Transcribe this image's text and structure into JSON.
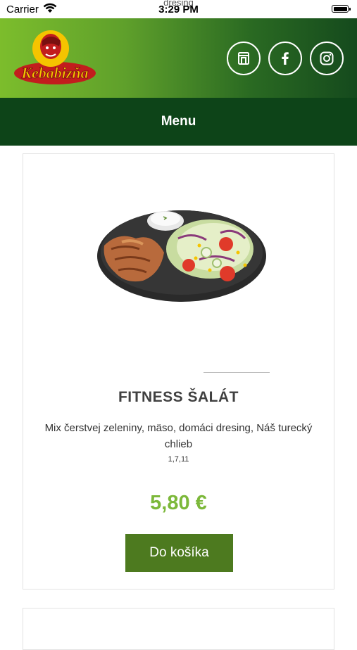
{
  "status_bar": {
    "carrier": "Carrier",
    "time": "3:29 PM",
    "ghost_text": "dresing"
  },
  "header": {
    "logo_text": "Kebabizňa",
    "social_icons": [
      "shop-icon",
      "facebook-icon",
      "instagram-icon"
    ],
    "colors": {
      "gradient_start": "#7cbd2c",
      "gradient_end": "#154a1d"
    }
  },
  "nav": {
    "menu_label": "Menu",
    "color": "#0d4418"
  },
  "product": {
    "name": "FITNESS ŠALÁT",
    "description": "Mix čerstvej zeleniny, mäso, domáci dresing, Náš turecký chlieb",
    "allergens": "1,7,11",
    "price": "5,80 €",
    "price_color": "#7cb83a",
    "add_to_cart_label": "Do košíka",
    "button_color": "#4d7a1f"
  }
}
